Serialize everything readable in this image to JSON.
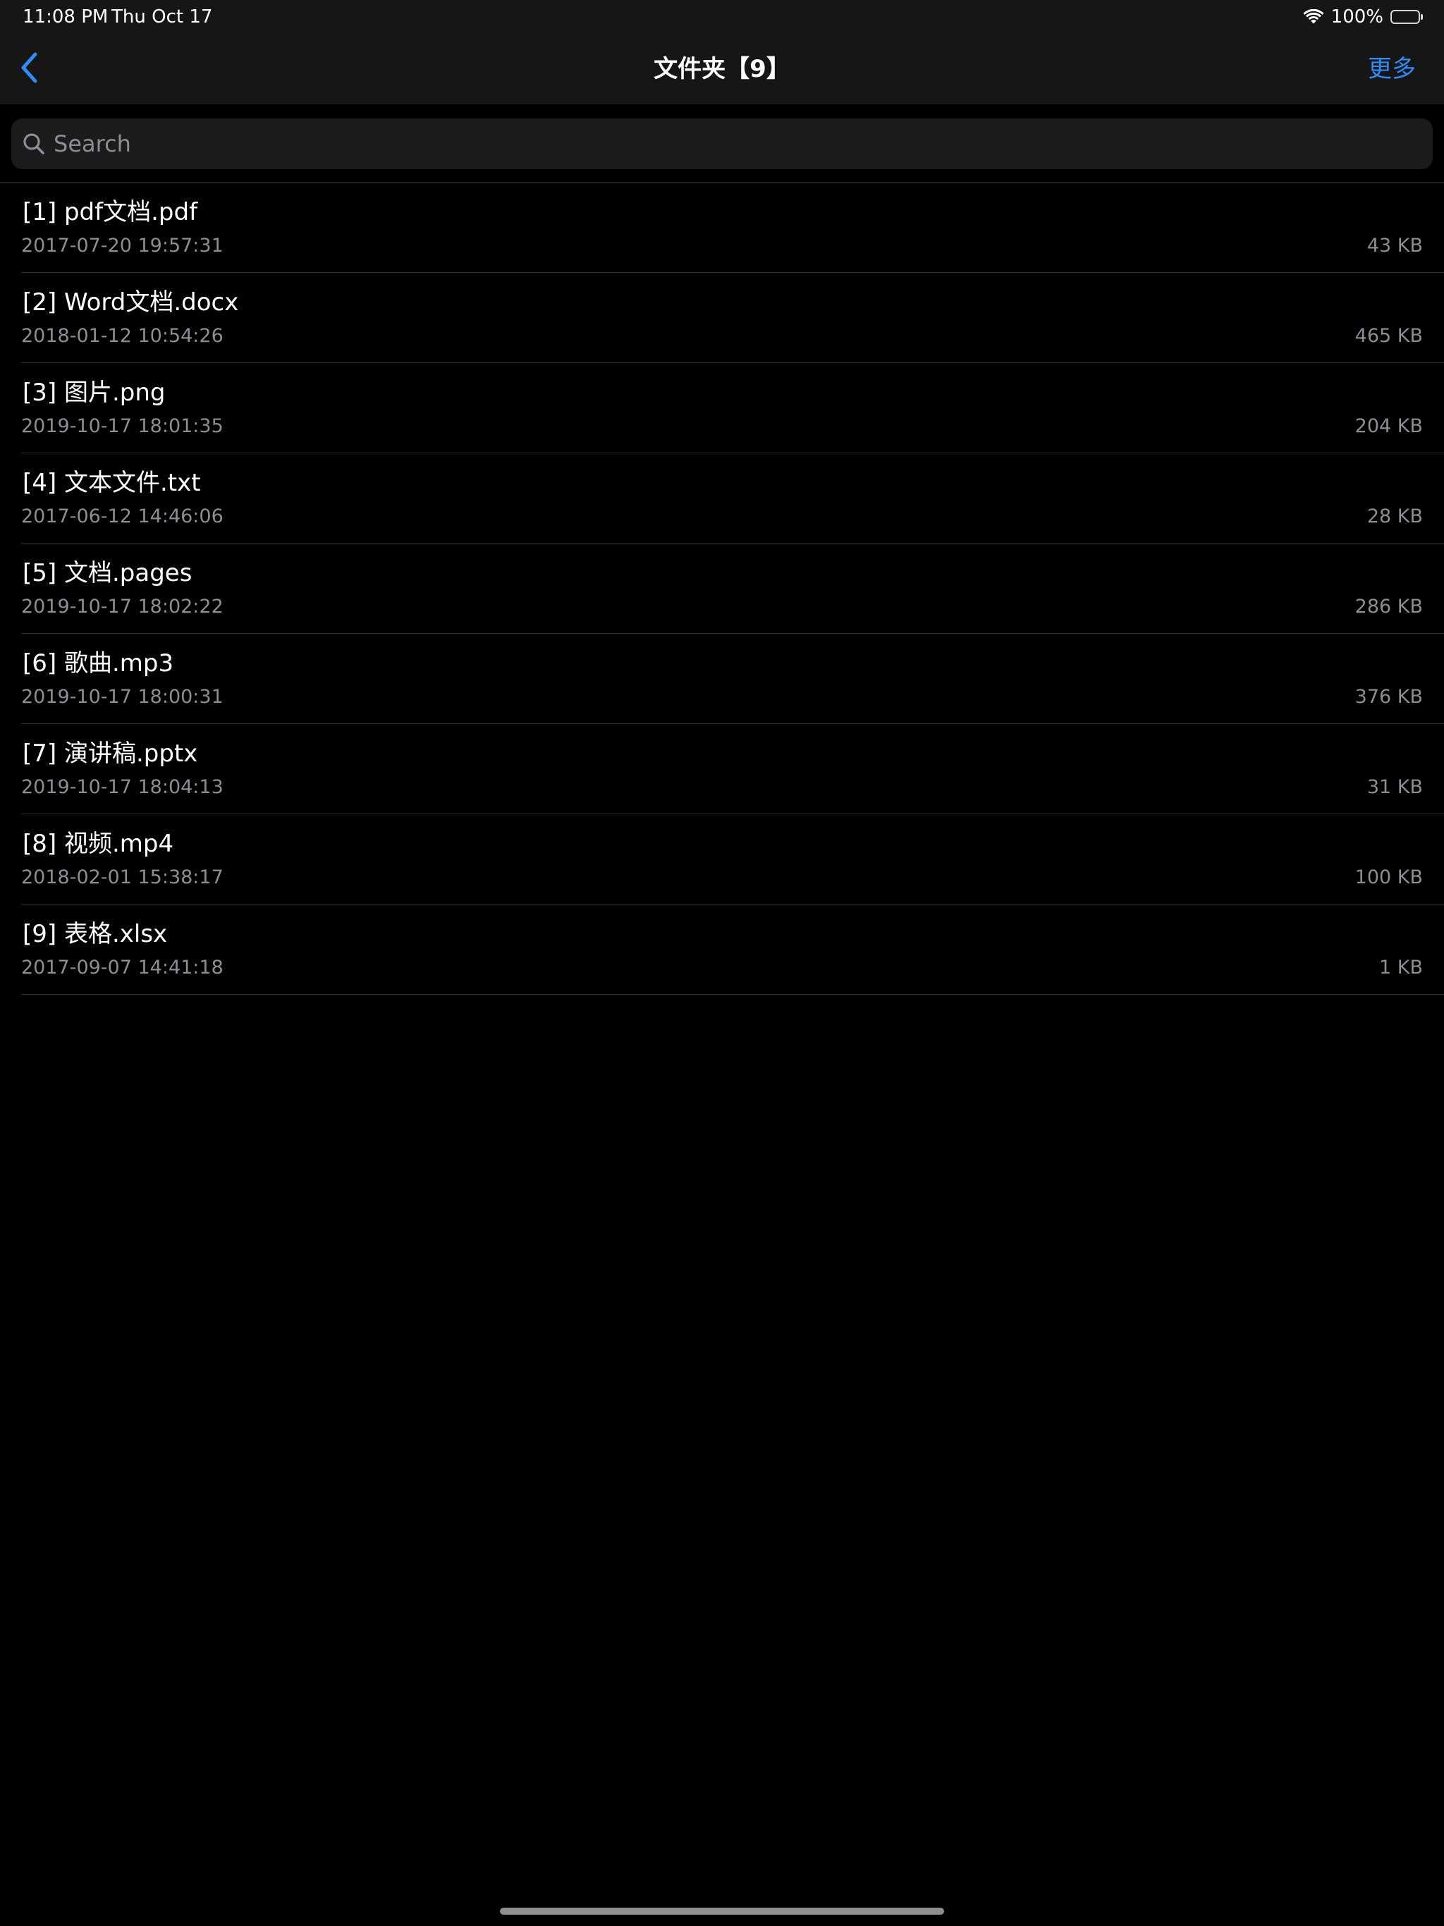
{
  "status_bar": {
    "time": "11:08 PM",
    "date": "Thu Oct 17",
    "battery_percent": "100%",
    "battery_level": 1.0,
    "wifi_icon": "wifi-icon",
    "battery_icon": "battery-icon"
  },
  "nav": {
    "back_icon": "chevron-left-icon",
    "title": "文件夹【9】",
    "more_label": "更多",
    "accent_color": "#2f8cf5"
  },
  "search": {
    "placeholder": "Search",
    "value": "",
    "icon": "search-icon"
  },
  "files": [
    {
      "name": "[1] pdf文档.pdf",
      "date": "2017-07-20 19:57:31",
      "size": "43 KB"
    },
    {
      "name": "[2] Word文档.docx",
      "date": "2018-01-12 10:54:26",
      "size": "465 KB"
    },
    {
      "name": "[3] 图片.png",
      "date": "2019-10-17 18:01:35",
      "size": "204 KB"
    },
    {
      "name": "[4] 文本文件.txt",
      "date": "2017-06-12 14:46:06",
      "size": "28 KB"
    },
    {
      "name": "[5] 文档.pages",
      "date": "2019-10-17 18:02:22",
      "size": "286 KB"
    },
    {
      "name": "[6] 歌曲.mp3",
      "date": "2019-10-17 18:00:31",
      "size": "376 KB"
    },
    {
      "name": "[7] 演讲稿.pptx",
      "date": "2019-10-17 18:04:13",
      "size": "31 KB"
    },
    {
      "name": "[8] 视频.mp4",
      "date": "2018-02-01 15:38:17",
      "size": "100 KB"
    },
    {
      "name": "[9] 表格.xlsx",
      "date": "2017-09-07 14:41:18",
      "size": "1 KB"
    }
  ],
  "colors": {
    "background": "#000000",
    "bar_background": "#161616",
    "search_background": "#1c1c1e",
    "secondary_text": "#8d8d93",
    "separator": "#2a2a2c"
  }
}
